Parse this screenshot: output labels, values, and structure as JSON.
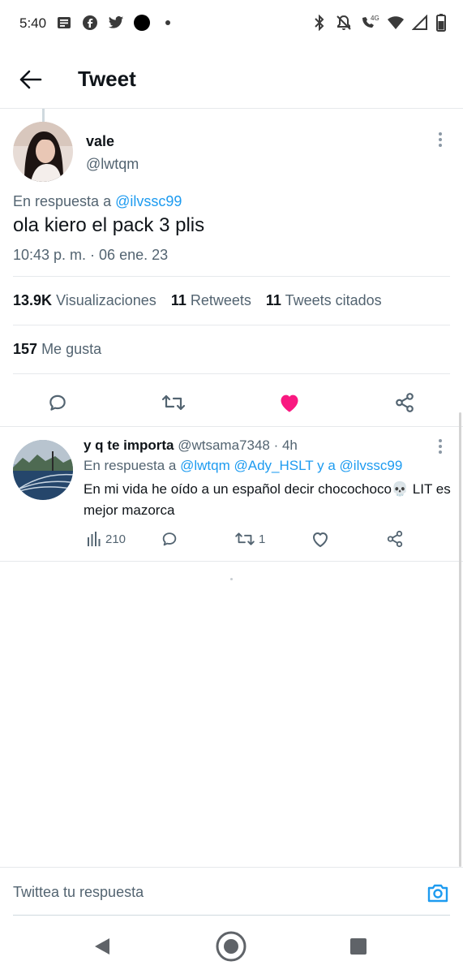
{
  "status_bar": {
    "time": "5:40",
    "left_icons": [
      "notes-icon",
      "facebook-icon",
      "twitter-icon",
      "black-circle-icon",
      "dot-icon"
    ],
    "right_icons": [
      "bluetooth-icon",
      "mute-icon",
      "wifi-call-icon",
      "wifi-icon",
      "signal-icon",
      "battery-icon"
    ],
    "network_label": "4G"
  },
  "header": {
    "title": "Tweet"
  },
  "main_tweet": {
    "author_name": "vale",
    "author_handle": "@lwtqm",
    "reply_prefix": "En respuesta a",
    "reply_to": "@ilvssc99",
    "text": "ola kiero el pack 3 plis",
    "timestamp": "10:43 p. m. · 06 ene. 23",
    "stats": {
      "views_count": "13.9K",
      "views_label": "Visualizaciones",
      "retweets_count": "11",
      "retweets_label": "Retweets",
      "quotes_count": "11",
      "quotes_label": "Tweets citados",
      "likes_count": "157",
      "likes_label": "Me gusta"
    },
    "liked": true,
    "like_color": "#f91880"
  },
  "reply_tweet": {
    "author_name": "y q te importa",
    "author_handle": "@wtsama7348",
    "time_ago": "· 4h",
    "reply_prefix": "En respuesta a",
    "mention_1": "@lwtqm",
    "mention_2": "@Ady_HSLT",
    "and_text": "y a",
    "mention_3": "@ilvssc99",
    "text": "En mi vida he oído a un español decir chocochoco💀 LIT es mejor mazorca",
    "views": "210",
    "retweets": "1"
  },
  "compose": {
    "placeholder": "Twittea tu respuesta"
  },
  "colors": {
    "accent": "#1d9bf0",
    "text_secondary": "#536471",
    "like": "#f91880"
  }
}
